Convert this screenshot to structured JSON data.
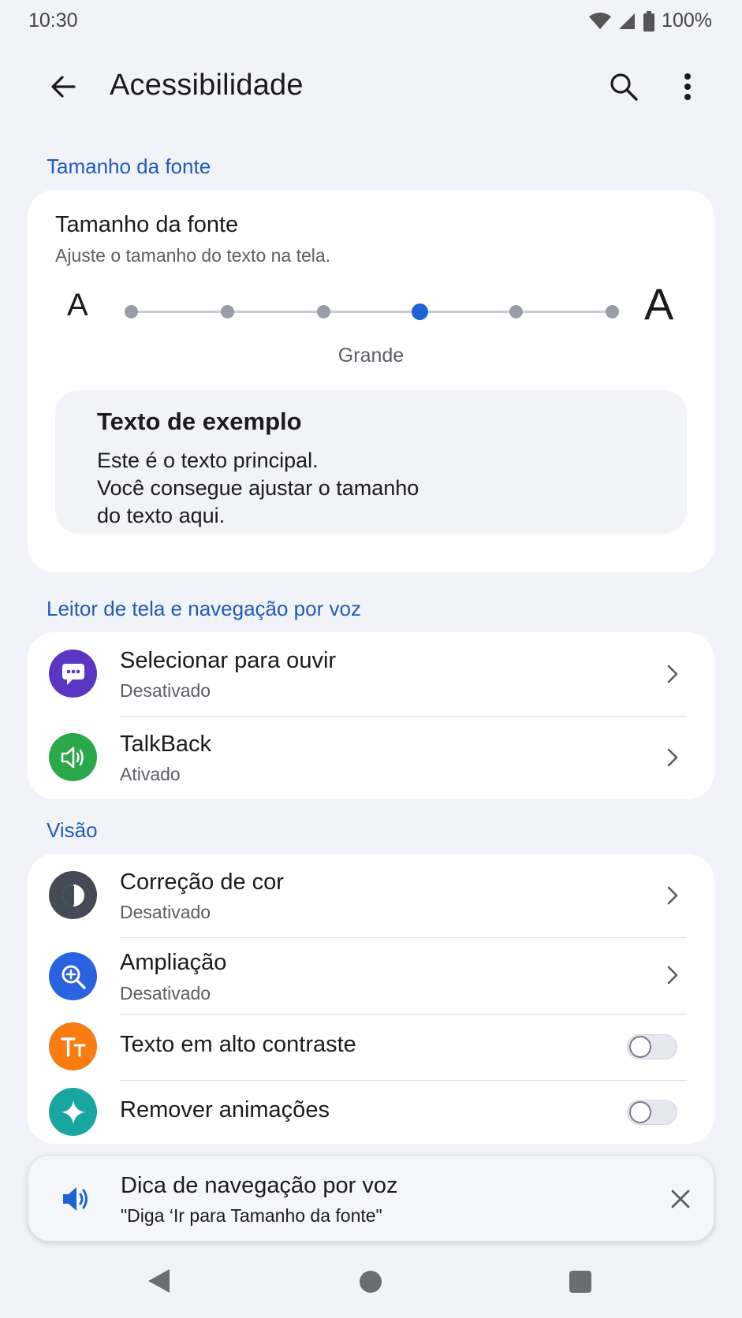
{
  "status_bar": {
    "time": "10:30",
    "battery": "100%",
    "icons": [
      "wifi-icon",
      "signal-icon",
      "battery-icon"
    ]
  },
  "app_bar": {
    "title": "Acessibilidade",
    "back_icon": "arrow-back-icon",
    "search_icon": "search-icon",
    "more_icon": "more-vert-icon"
  },
  "font_size": {
    "section_header": "Tamanho da fonte",
    "title": "Tamanho da fonte",
    "subtitle": "Ajuste o tamanho do texto na tela.",
    "small_label": "A",
    "large_label": "A",
    "steps": 6,
    "selected_step": 4,
    "selected_label": "Grande",
    "preview_title": "Texto de exemplo",
    "preview_lines": [
      "Este é o texto principal.",
      "Você consegue ajustar o tamanho",
      "do texto aqui."
    ]
  },
  "screen_reader": {
    "section_header": "Leitor de tela e navegação por voz",
    "items": [
      {
        "title": "Selecionar para ouvir",
        "status": "Desativado",
        "icon": "chat-bubble-icon",
        "color": "#5b35c4"
      },
      {
        "title": "TalkBack",
        "status": "Ativado",
        "icon": "speaker-icon",
        "color": "#2aa84a"
      }
    ]
  },
  "vision": {
    "section_header": "Visão",
    "items": [
      {
        "title": "Correção de cor",
        "status": "Desativado",
        "icon": "color-correction-icon",
        "color": "#454a57",
        "control": "chevron"
      },
      {
        "title": "Ampliação",
        "status": "Desativado",
        "icon": "magnify-icon",
        "color": "#2b62e0",
        "control": "chevron"
      },
      {
        "title": "Texto em alto contraste",
        "icon": "text-contrast-icon",
        "color": "#f77c12",
        "control": "toggle",
        "on": false
      },
      {
        "title": "Remover animações",
        "icon": "sparkle-icon",
        "color": "#1aa6a0",
        "control": "toggle",
        "on": false
      }
    ]
  },
  "voice_tip": {
    "title": "Dica de navegação por voz",
    "subtitle": "\"Diga ‘Ir para Tamanho da fonte\"",
    "icon": "volume-icon",
    "close_icon": "close-icon"
  },
  "nav_bar": {
    "icons": [
      "nav-back-icon",
      "nav-home-icon",
      "nav-recents-icon"
    ]
  }
}
